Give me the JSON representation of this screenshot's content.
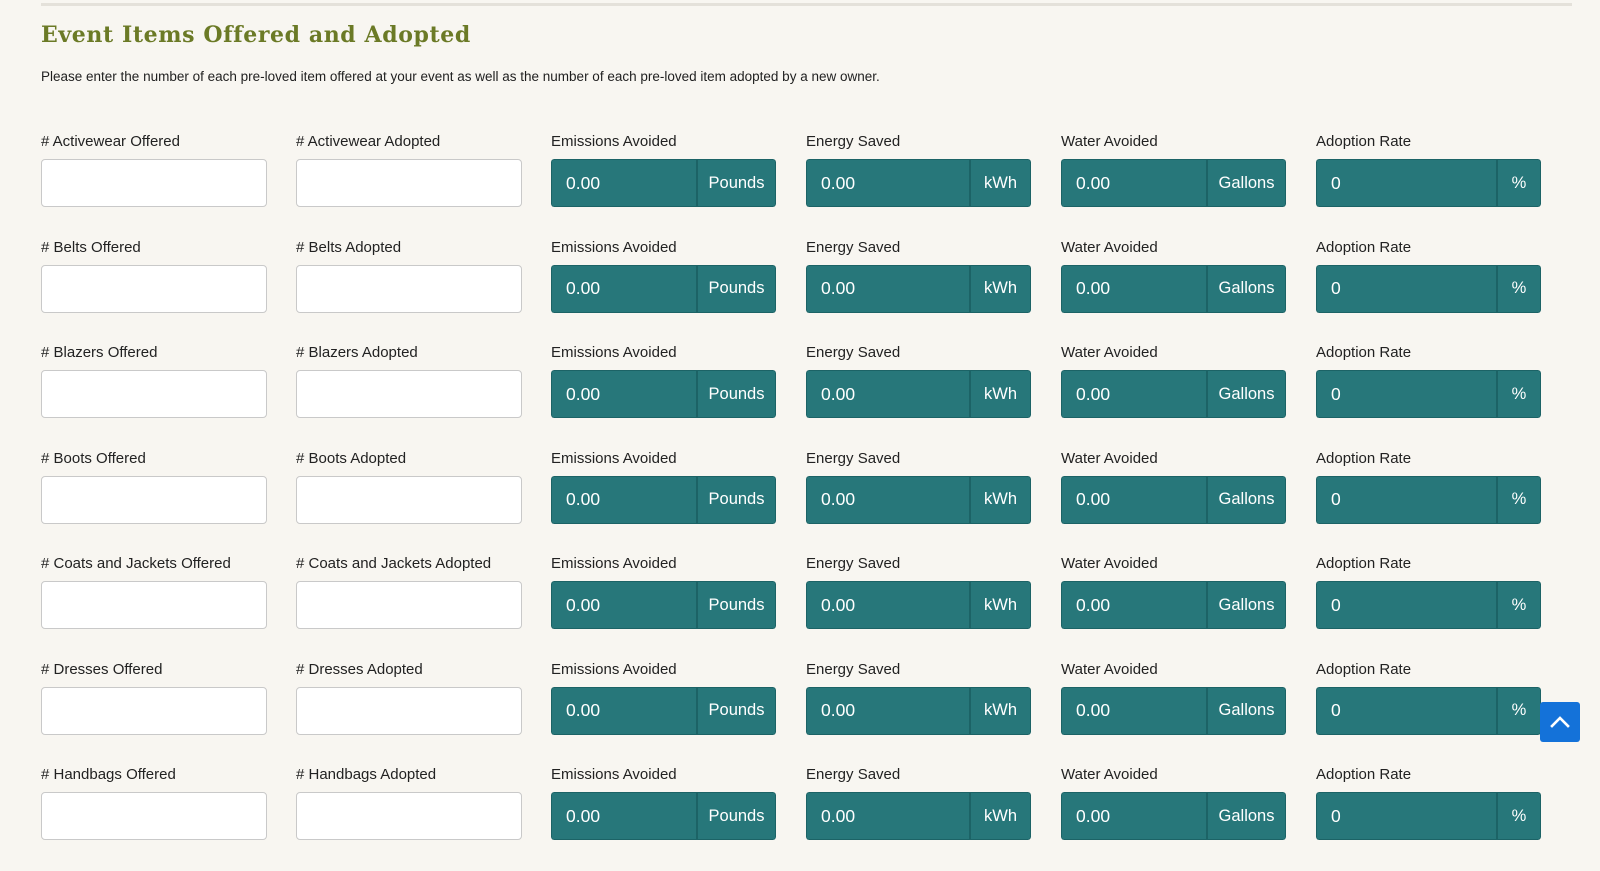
{
  "section": {
    "title": "Event Items Offered and Adopted",
    "instructions": "Please enter the number of each pre-loved item offered at your event as well as the number of each pre-loved item adopted by a new owner."
  },
  "metric_labels": {
    "emissions": "Emissions Avoided",
    "energy": "Energy Saved",
    "water": "Water Avoided",
    "adoption": "Adoption Rate"
  },
  "units": {
    "emissions": "Pounds",
    "energy": "kWh",
    "water": "Gallons",
    "adoption": "%"
  },
  "rows": [
    {
      "offered_label": "# Activewear Offered",
      "adopted_label": "# Activewear Adopted",
      "offered_value": "",
      "adopted_value": "",
      "emissions": "0.00",
      "energy": "0.00",
      "water": "0.00",
      "adoption": "0"
    },
    {
      "offered_label": "# Belts Offered",
      "adopted_label": "# Belts Adopted",
      "offered_value": "",
      "adopted_value": "",
      "emissions": "0.00",
      "energy": "0.00",
      "water": "0.00",
      "adoption": "0"
    },
    {
      "offered_label": "# Blazers Offered",
      "adopted_label": "# Blazers Adopted",
      "offered_value": "",
      "adopted_value": "",
      "emissions": "0.00",
      "energy": "0.00",
      "water": "0.00",
      "adoption": "0"
    },
    {
      "offered_label": "# Boots Offered",
      "adopted_label": "# Boots Adopted",
      "offered_value": "",
      "adopted_value": "",
      "emissions": "0.00",
      "energy": "0.00",
      "water": "0.00",
      "adoption": "0"
    },
    {
      "offered_label": "# Coats and Jackets Offered",
      "adopted_label": "# Coats and Jackets Adopted",
      "offered_value": "",
      "adopted_value": "",
      "emissions": "0.00",
      "energy": "0.00",
      "water": "0.00",
      "adoption": "0"
    },
    {
      "offered_label": "# Dresses Offered",
      "adopted_label": "# Dresses Adopted",
      "offered_value": "",
      "adopted_value": "",
      "emissions": "0.00",
      "energy": "0.00",
      "water": "0.00",
      "adoption": "0"
    },
    {
      "offered_label": "# Handbags Offered",
      "adopted_label": "# Handbags Adopted",
      "offered_value": "",
      "adopted_value": "",
      "emissions": "0.00",
      "energy": "0.00",
      "water": "0.00",
      "adoption": "0"
    }
  ],
  "scroll_top": {
    "icon": "chevron-up-icon"
  },
  "colors": {
    "accent_teal": "#27777a",
    "title_olive": "#6b7a26",
    "scroll_button_blue": "#1472d9",
    "background": "#f8f6f1"
  }
}
